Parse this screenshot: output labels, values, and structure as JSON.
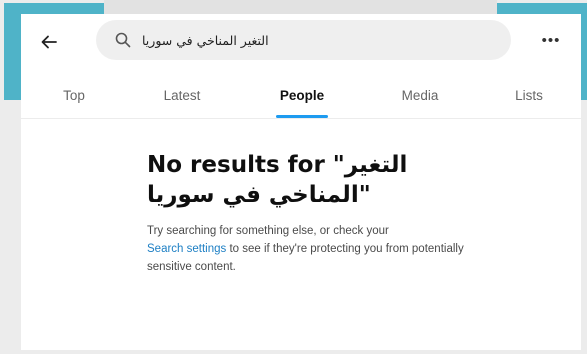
{
  "header": {
    "back_icon": "arrow-left-icon",
    "search_icon": "search-icon",
    "more_icon": "more-horizontal-icon",
    "more_label": "•••"
  },
  "search": {
    "value": "التغير المناخي في سوريا"
  },
  "tabs": [
    {
      "label": "Top"
    },
    {
      "label": "Latest"
    },
    {
      "label": "People"
    },
    {
      "label": "Media"
    },
    {
      "label": "Lists"
    }
  ],
  "active_tab": "People",
  "empty_state": {
    "title_line1": "No results for \"التغير",
    "title_line2": "المناخي في سوريا\"",
    "text_before_link": "Try searching for something else, or check your",
    "link_label": "Search settings",
    "text_after_link": " to see if they're protecting you from potentially sensitive content."
  },
  "colors": {
    "accent_frame": "#4fb3c8",
    "link": "#1d7fc4",
    "tab_indicator": "#1d9bf0"
  }
}
